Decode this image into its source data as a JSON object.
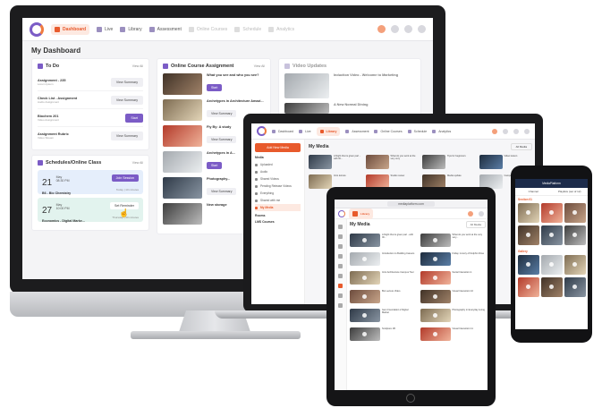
{
  "desktop": {
    "nav": [
      {
        "label": "Dashboard",
        "state": "active"
      },
      {
        "label": "Live",
        "state": "normal"
      },
      {
        "label": "Library",
        "state": "normal"
      },
      {
        "label": "Assessment",
        "state": "normal"
      },
      {
        "label": "Online Courses",
        "state": "faint"
      },
      {
        "label": "Schedule",
        "state": "faint"
      },
      {
        "label": "Analytics",
        "state": "faint"
      }
    ],
    "page_title": "My Dashboard",
    "todo": {
      "title": "To Do",
      "view_all": "View All",
      "items": [
        {
          "title": "Assignment - 235",
          "sub": "Lorem Ipsum",
          "button": "View Summary"
        },
        {
          "title": "Check List - Assignment",
          "sub": "Audio Assignment",
          "button": "View Summary"
        },
        {
          "title": "Biochem 201",
          "sub": "Video Assignment",
          "button": "Start"
        },
        {
          "title": "Assignment Rubric",
          "sub": "Video Stream",
          "button": "View Summary"
        }
      ]
    },
    "schedules": {
      "title": "Schedules/Online Class",
      "view_all": "View All",
      "items": [
        {
          "day": "21",
          "month": "May",
          "time": "08:30 PM",
          "subject": "B6 - Bio Chemistry",
          "meta": "Today | 10 minutes",
          "button": "Join Session"
        },
        {
          "day": "27",
          "month": "May",
          "time": "10:00 PM",
          "subject": "Economics - Digital Marke...",
          "meta": "Thursday | 30 minutes",
          "button": "Set Reminder"
        }
      ]
    },
    "courses": {
      "title": "Online Course Assignment",
      "view_all": "View All",
      "items": [
        {
          "q": "What you see and who you see?",
          "button": "Start"
        },
        {
          "q": "Archetypes in Architecture Amazi...",
          "button": "View Summary"
        },
        {
          "q": "Fly By: A study",
          "button": "View Summary"
        },
        {
          "q": "Archetypes in A...",
          "button": "Start"
        },
        {
          "q": "Photography...",
          "button": "View Summary"
        },
        {
          "q": "New storage",
          "button": ""
        }
      ]
    },
    "videos": {
      "title": "Video Updates",
      "items": [
        {
          "title": "Induction Video - Welcome to Marketing"
        },
        {
          "title": "A New Normal Dining"
        }
      ]
    }
  },
  "laptop": {
    "nav": [
      "Dashboard",
      "Live",
      "Library",
      "Assessment",
      "Online Courses",
      "Schedule",
      "Analytics"
    ],
    "active_nav": "Library",
    "add_button": "Add New Media",
    "side_section": "Media",
    "side_items": [
      "Uploaded",
      "Audio",
      "Shared Videos",
      "Pending Release Videos",
      "Everything",
      "Shared with me",
      "My Media"
    ],
    "side_selected": "My Media",
    "side_footer": [
      "Rooms",
      "LMS Courses"
    ],
    "title": "My Media",
    "sort": "All Media",
    "cards": [
      "A Night that is given part - with ID...",
      "What do you work at the very very",
      "Tips for beginners",
      "Video lesson",
      "Intro lecture",
      "Studio review",
      "Media update",
      "Campus tour"
    ]
  },
  "tablet": {
    "url": "mediaplatform.com",
    "active_nav": "Library",
    "title": "My Media",
    "filter": "All Media",
    "cards": [
      "A Night that is given part - with ID...",
      "What do you work at the very very...",
      "Introduction to Building Careers",
      "Friday: A story of Dolphin Drive",
      "Intro Architecture Campus Tour",
      "Social Interaction 1",
      "Bio Lecture Video",
      "Visual Interaction 10",
      "Gem Foundation 2 Digital Market",
      "Photography in Everyday Living",
      "Sculpture 1B",
      "Visual Interaction 11"
    ]
  },
  "phone": {
    "header": "MediaPlatform",
    "tabs": [
      "Channel",
      "Playlists (out of 12)"
    ],
    "sections": [
      "Section 01",
      "Gallery"
    ]
  }
}
